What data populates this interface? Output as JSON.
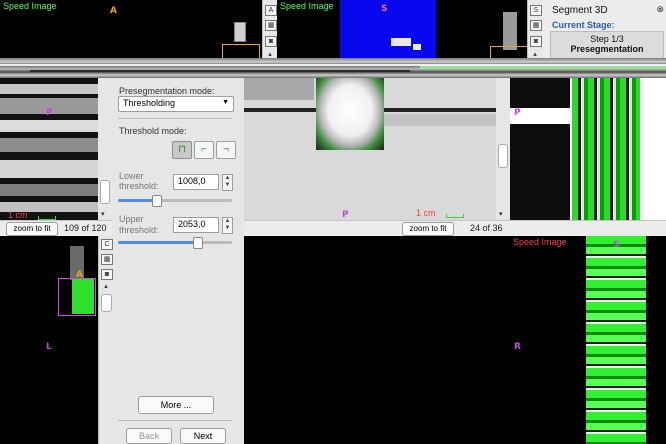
{
  "views": {
    "top_left": {
      "overlay": "Speed Image",
      "orientation": "A"
    },
    "top_mid": {
      "overlay": "Speed Image",
      "orientation": "S"
    },
    "mid_left": {
      "orientation": "P",
      "scale": "1 cm"
    },
    "mid_center": {
      "orientation": "P",
      "scale": "1 cm"
    },
    "mid_right": {
      "orientation": "P"
    },
    "bottom_left": {
      "orientation_a": "A",
      "orientation_l": "L"
    },
    "bottom_right": {
      "overlay": "Speed Image",
      "orientation_s": "S",
      "orientation_r": "R"
    }
  },
  "view_tools": {
    "toggle_3d_a": "A",
    "toggle_3d_s": "S",
    "toggle_3d_c": "C"
  },
  "status": {
    "left_zoom_label": "zoom to fit",
    "left_slice": "109 of 120",
    "center_zoom_label": "zoom to fit",
    "center_slice": "24 of 36"
  },
  "segment_panel": {
    "title": "Segment 3D",
    "stage_label": "Current Stage:",
    "step": "Step 1/3",
    "stage_name": "Presegmentation"
  },
  "preseg": {
    "mode_label": "Presegmentation mode:",
    "mode_value": "Thresholding",
    "threshold_mode_label": "Threshold mode:",
    "lower_label_1": "Lower",
    "lower_label_2": "threshold:",
    "lower_value": "1008,0",
    "lower_fraction": 0.33,
    "upper_label_1": "Upper",
    "upper_label_2": "threshold:",
    "upper_value": "2053,0",
    "upper_fraction": 0.69,
    "more_label": "More ...",
    "back_label": "Back",
    "next_label": "Next"
  },
  "colors": {
    "speed_text": "#52ff52",
    "orientation": "#c04bd6",
    "orange_tag": "#f0a020",
    "accent": "#2a5db0"
  }
}
